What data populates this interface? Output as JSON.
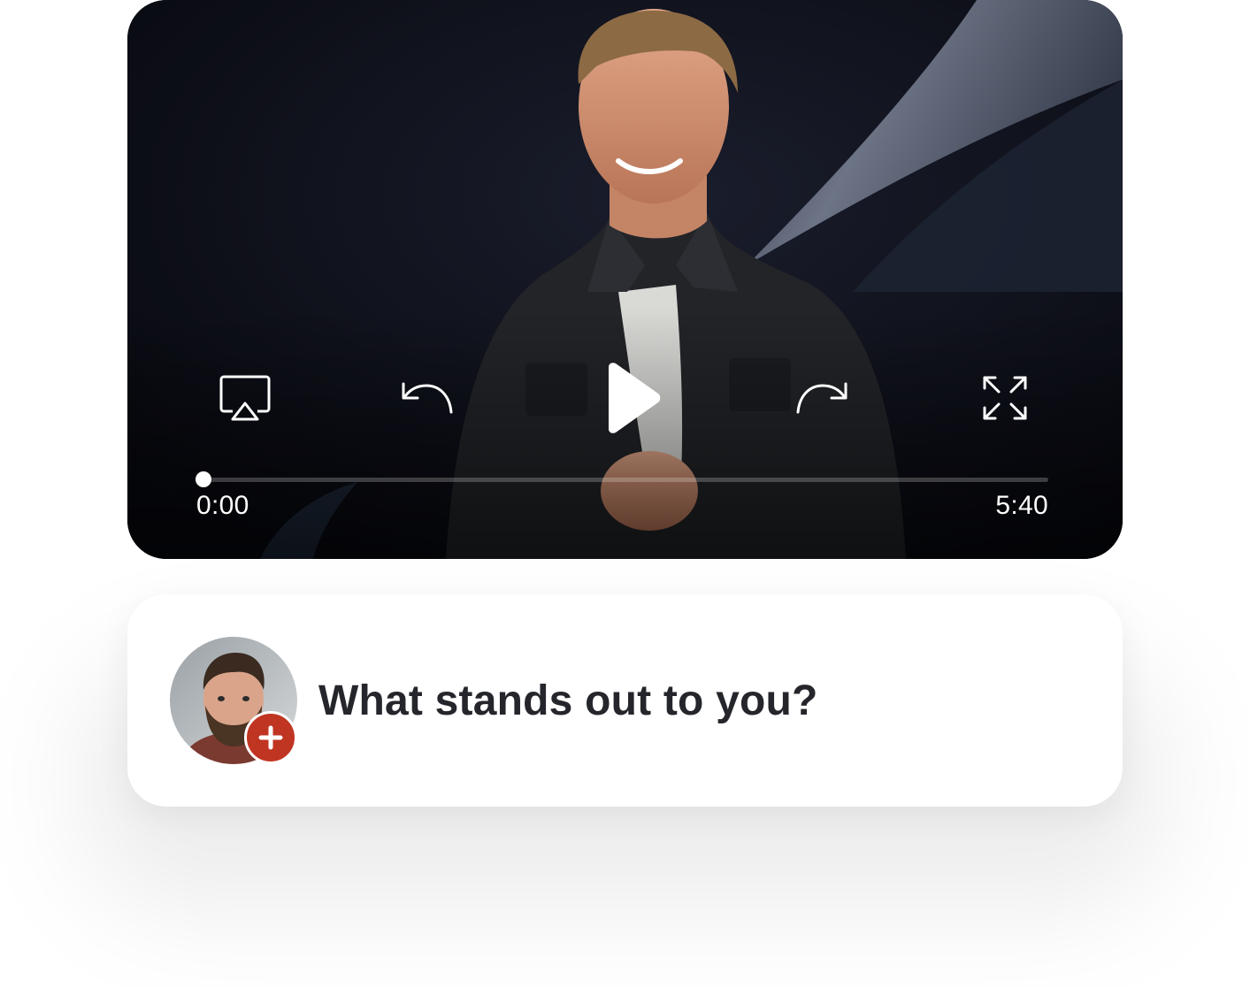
{
  "player": {
    "video_scene": "speaker-on-stage-image",
    "current_time": "0:00",
    "duration": "5:40",
    "progress": 0,
    "icons": {
      "airplay": "airplay-icon",
      "rewind": "rewind-icon",
      "play": "play-icon",
      "forward": "forward-icon",
      "fullscreen": "fullscreen-icon"
    }
  },
  "prompt": {
    "question": "What stands out to you?",
    "avatar_icon": "avatar",
    "badge_icon": "plus-icon",
    "badge_color": "#c03522"
  },
  "colors": {
    "video_background": "#0b0c14",
    "control_color": "#ffffff",
    "text_dark": "#25262b"
  }
}
